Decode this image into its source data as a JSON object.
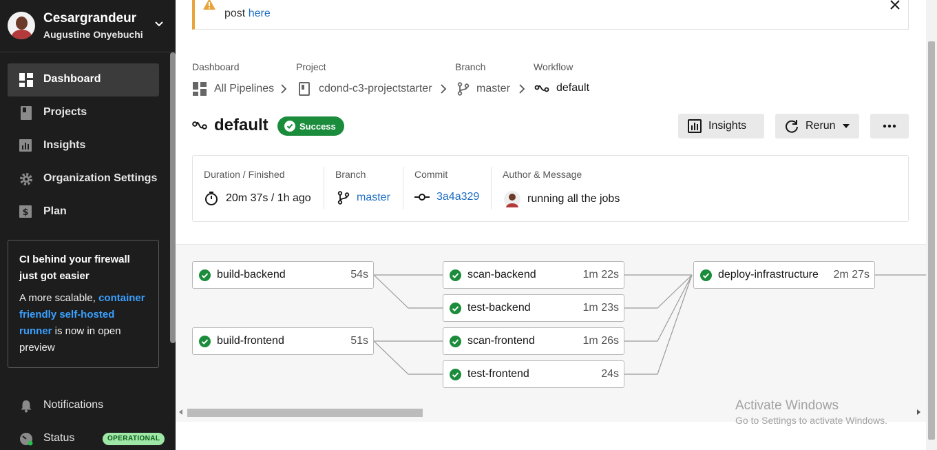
{
  "user": {
    "name": "Cesargrandeur",
    "subtitle": "Augustine Onyebuchi"
  },
  "nav": [
    {
      "label": "Dashboard",
      "icon": "dashboard-icon",
      "active": true
    },
    {
      "label": "Projects",
      "icon": "projects-icon",
      "active": false
    },
    {
      "label": "Insights",
      "icon": "insights-icon",
      "active": false
    },
    {
      "label": "Organization Settings",
      "icon": "gear-icon",
      "active": false
    },
    {
      "label": "Plan",
      "icon": "dollar-icon",
      "active": false
    }
  ],
  "promo": {
    "title": "CI behind your firewall just got easier",
    "text_before": "A more scalable, ",
    "link": "container friendly self-hosted runner",
    "text_after": " is now in open preview"
  },
  "bottom": {
    "notifications": "Notifications",
    "status": "Status",
    "status_badge": "OPERATIONAL"
  },
  "banner": {
    "text": "post ",
    "link": "here"
  },
  "breadcrumb": {
    "dashboard_label": "Dashboard",
    "dashboard_value": "All Pipelines",
    "project_label": "Project",
    "project_value": "cdond-c3-projectstarter",
    "branch_label": "Branch",
    "branch_value": "master",
    "workflow_label": "Workflow",
    "workflow_value": "default"
  },
  "header": {
    "title": "default",
    "status": "Success",
    "insights_button": "Insights",
    "rerun_button": "Rerun",
    "more_button": "..."
  },
  "meta": {
    "duration_label": "Duration / Finished",
    "duration_value": "20m 37s / 1h ago",
    "branch_label": "Branch",
    "branch_value": "master",
    "commit_label": "Commit",
    "commit_value": "3a4a329",
    "author_label": "Author & Message",
    "author_message": "running all the jobs"
  },
  "jobs": {
    "build_backend": {
      "name": "build-backend",
      "duration": "54s"
    },
    "build_frontend": {
      "name": "build-frontend",
      "duration": "51s"
    },
    "scan_backend": {
      "name": "scan-backend",
      "duration": "1m 22s"
    },
    "test_backend": {
      "name": "test-backend",
      "duration": "1m 23s"
    },
    "scan_frontend": {
      "name": "scan-frontend",
      "duration": "1m 26s"
    },
    "test_frontend": {
      "name": "test-frontend",
      "duration": "24s"
    },
    "deploy_infrastructure": {
      "name": "deploy-infrastructure",
      "duration": "2m 27s"
    }
  },
  "watermark": {
    "line1": "Activate Windows",
    "line2": "Go to Settings to activate Windows."
  },
  "colors": {
    "success": "#1b8c3c",
    "link": "#1c6cc4",
    "sidebar": "#1d1d1d",
    "warning": "#e8a33a"
  }
}
